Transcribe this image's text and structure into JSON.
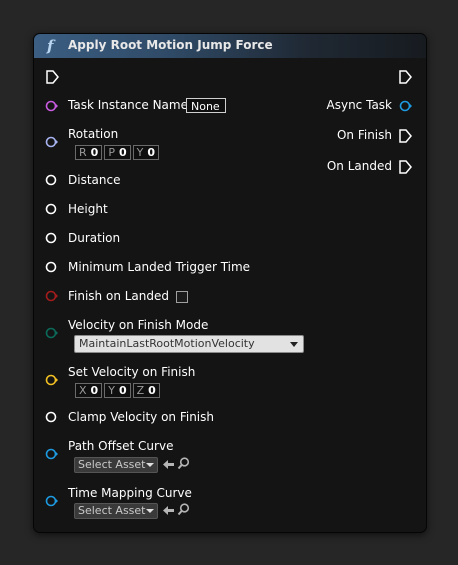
{
  "node": {
    "title": "Apply Root Motion Jump Force",
    "func_symbol": "f"
  },
  "outputs": {
    "async_task": "Async Task",
    "on_finish": "On Finish",
    "on_landed": "On Landed"
  },
  "inputs": {
    "task_instance_name": {
      "label": "Task Instance Name",
      "value": "None"
    },
    "rotation": {
      "label": "Rotation",
      "components": [
        {
          "axis": "R",
          "value": "0"
        },
        {
          "axis": "P",
          "value": "0"
        },
        {
          "axis": "Y",
          "value": "0"
        }
      ]
    },
    "distance": {
      "label": "Distance"
    },
    "height": {
      "label": "Height"
    },
    "duration": {
      "label": "Duration"
    },
    "min_landed_trigger_time": {
      "label": "Minimum Landed Trigger Time"
    },
    "finish_on_landed": {
      "label": "Finish on Landed",
      "checked": false
    },
    "velocity_on_finish_mode": {
      "label": "Velocity on Finish Mode",
      "selected": "MaintainLastRootMotionVelocity"
    },
    "set_velocity_on_finish": {
      "label": "Set Velocity on Finish",
      "components": [
        {
          "axis": "X",
          "value": "0"
        },
        {
          "axis": "Y",
          "value": "0"
        },
        {
          "axis": "Z",
          "value": "0"
        }
      ]
    },
    "clamp_velocity_on_finish": {
      "label": "Clamp Velocity on Finish"
    },
    "path_offset_curve": {
      "label": "Path Offset Curve",
      "asset": "Select Asset"
    },
    "time_mapping_curve": {
      "label": "Time Mapping Curve",
      "asset": "Select Asset"
    }
  },
  "colors": {
    "object_pin": "#c95ce0",
    "rotator_pin": "#a7b3f0",
    "float_pin": "#ffffff",
    "bool_pin": "#a31c1c",
    "enum_pin": "#0b6a5a",
    "vector_pin": "#f2c023",
    "curve_pin": "#1e9ae0",
    "exec_pin": "#ffffff"
  },
  "icons": [
    "exec-in-icon",
    "exec-out-icon",
    "browse-arrow-icon",
    "search-icon"
  ]
}
